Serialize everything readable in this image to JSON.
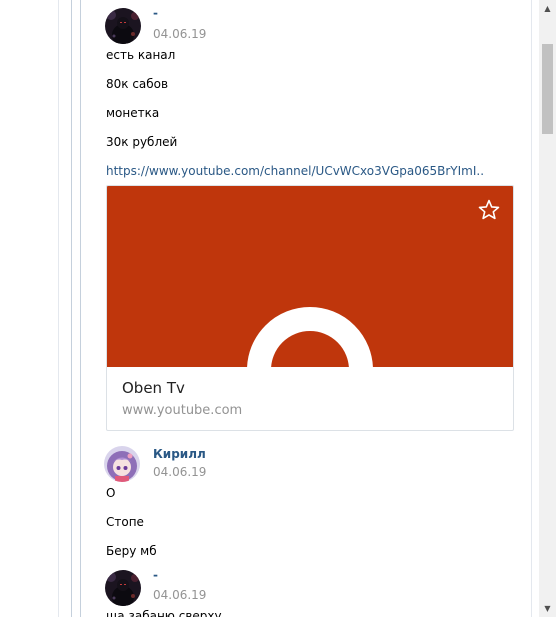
{
  "posts": [
    {
      "author": "-",
      "date": "04.06.19",
      "lines": [
        "есть канал",
        "80к сабов",
        "монетка",
        "30к рублей"
      ],
      "link_text": "https://www.youtube.com/channel/UCvWCxo3VGpa065BrYImI..",
      "preview": {
        "title": "Oben Tv",
        "domain": "www.youtube.com",
        "star_icon": "star-outline-icon",
        "color": "#bf360c"
      }
    },
    {
      "author": "Кирилл",
      "date": "04.06.19",
      "lines": [
        "О",
        "Стопе",
        "Беру мб"
      ]
    },
    {
      "author": "-",
      "date": "04.06.19",
      "lines": [
        "ща забаню сверху"
      ]
    }
  ],
  "scrollbar": {
    "up_icon": "▲",
    "down_icon": "▼"
  },
  "colors": {
    "link": "#2a5885",
    "date": "#939393",
    "preview_bg": "#bf360c"
  }
}
